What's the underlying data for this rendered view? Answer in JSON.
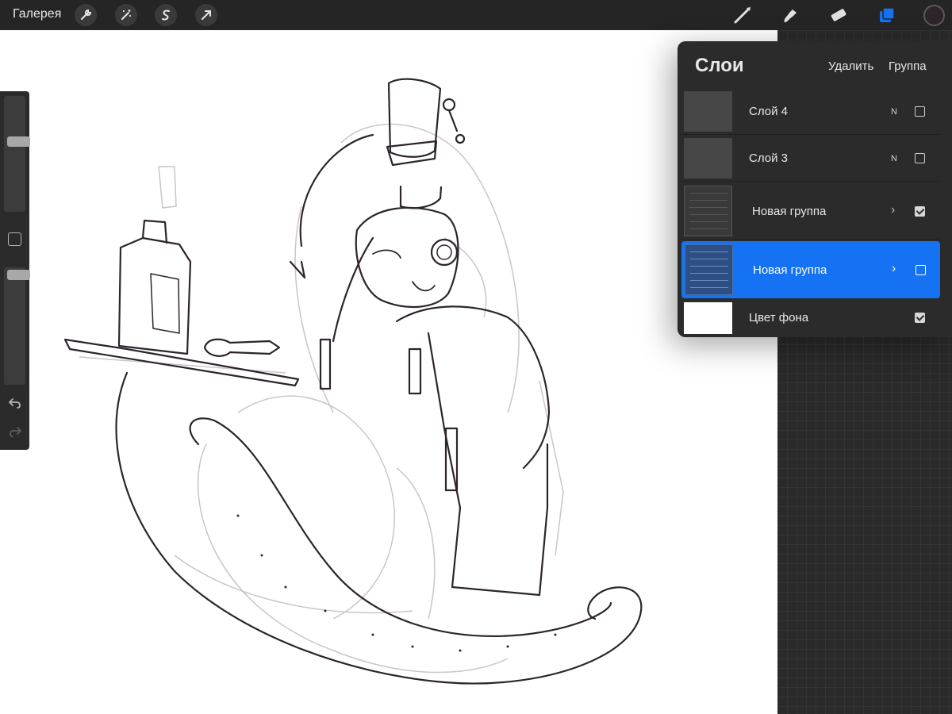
{
  "topbar": {
    "gallery_label": "Галерея",
    "left_tools": [
      "wrench-icon",
      "magic-wand-icon",
      "selection-icon",
      "transform-arrow-icon"
    ],
    "right_tools": [
      "brush-icon",
      "smudge-icon",
      "eraser-icon",
      "layers-icon"
    ],
    "active_tool": "layers-icon",
    "accent_color": "#1572f2",
    "current_color": "#2d242c"
  },
  "sidebar": {
    "brush_size_fraction": 0.62,
    "opacity_fraction": 0.98,
    "icons": [
      "modify-square-icon",
      "undo-icon",
      "redo-icon"
    ]
  },
  "layers_panel": {
    "title": "Слои",
    "delete_label": "Удалить",
    "group_label": "Группа",
    "layers": [
      {
        "name": "Слой 4",
        "blend": "N",
        "visible": false,
        "thumb": "gray"
      },
      {
        "name": "Слой 3",
        "blend": "N",
        "visible": false,
        "thumb": "gray"
      },
      {
        "name": "Новая группа",
        "blend": "",
        "visible": true,
        "thumb": "group",
        "expandable": true
      },
      {
        "name": "Новая группа",
        "blend": "",
        "visible": false,
        "thumb": "group",
        "expandable": true,
        "selected": true
      },
      {
        "name": "Цвет фона",
        "blend": "",
        "visible": true,
        "thumb": "white"
      }
    ]
  },
  "canvas": {
    "background": "#ffffff",
    "ink_color": "#2d242c"
  }
}
